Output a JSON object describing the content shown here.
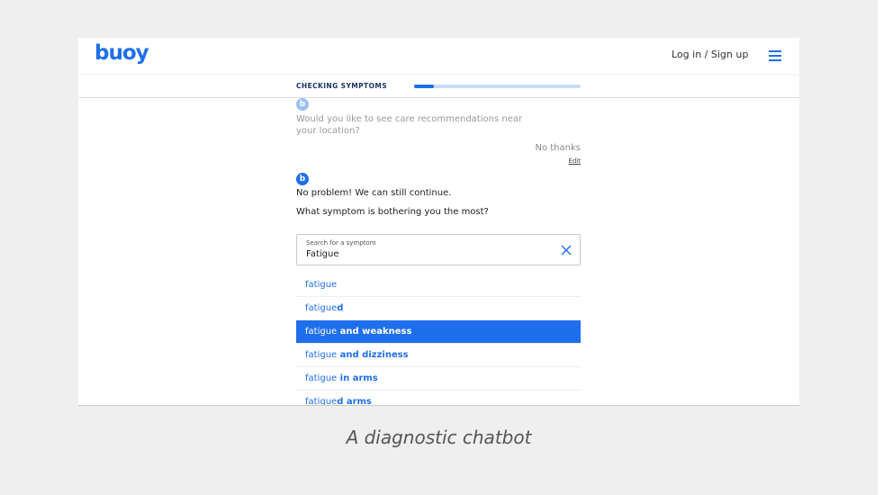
{
  "header": {
    "logo": "buoy",
    "auth_link": "Log in / Sign up",
    "menu_icon": "hamburger-menu-icon"
  },
  "progress": {
    "label": "CHECKING SYMPTOMS",
    "value": 0.12
  },
  "colors": {
    "accent": "#1f6fec",
    "track": "#c9ddf8"
  },
  "chat": {
    "avatar_letter": "b",
    "previous_question": "Would you like to see care recommendations near your location?",
    "user_reply": "No thanks",
    "edit_label": "Edit",
    "bot_message_1": "No problem! We can still continue.",
    "bot_message_2": "What symptom is bothering you the most?"
  },
  "search": {
    "label": "Search for a symptom",
    "value": "Fatigue"
  },
  "results": [
    {
      "prefix": "fatigue",
      "suffix": "",
      "active": false
    },
    {
      "prefix": "fatigue",
      "suffix": "d",
      "active": false
    },
    {
      "prefix": "fatigue",
      "suffix": " and weakness",
      "active": true
    },
    {
      "prefix": "fatigue",
      "suffix": " and dizziness",
      "active": false
    },
    {
      "prefix": "fatigue",
      "suffix": " in arms",
      "active": false
    },
    {
      "prefix": "fatigue",
      "suffix": "d arms",
      "active": false
    }
  ],
  "caption": "A diagnostic chatbot"
}
